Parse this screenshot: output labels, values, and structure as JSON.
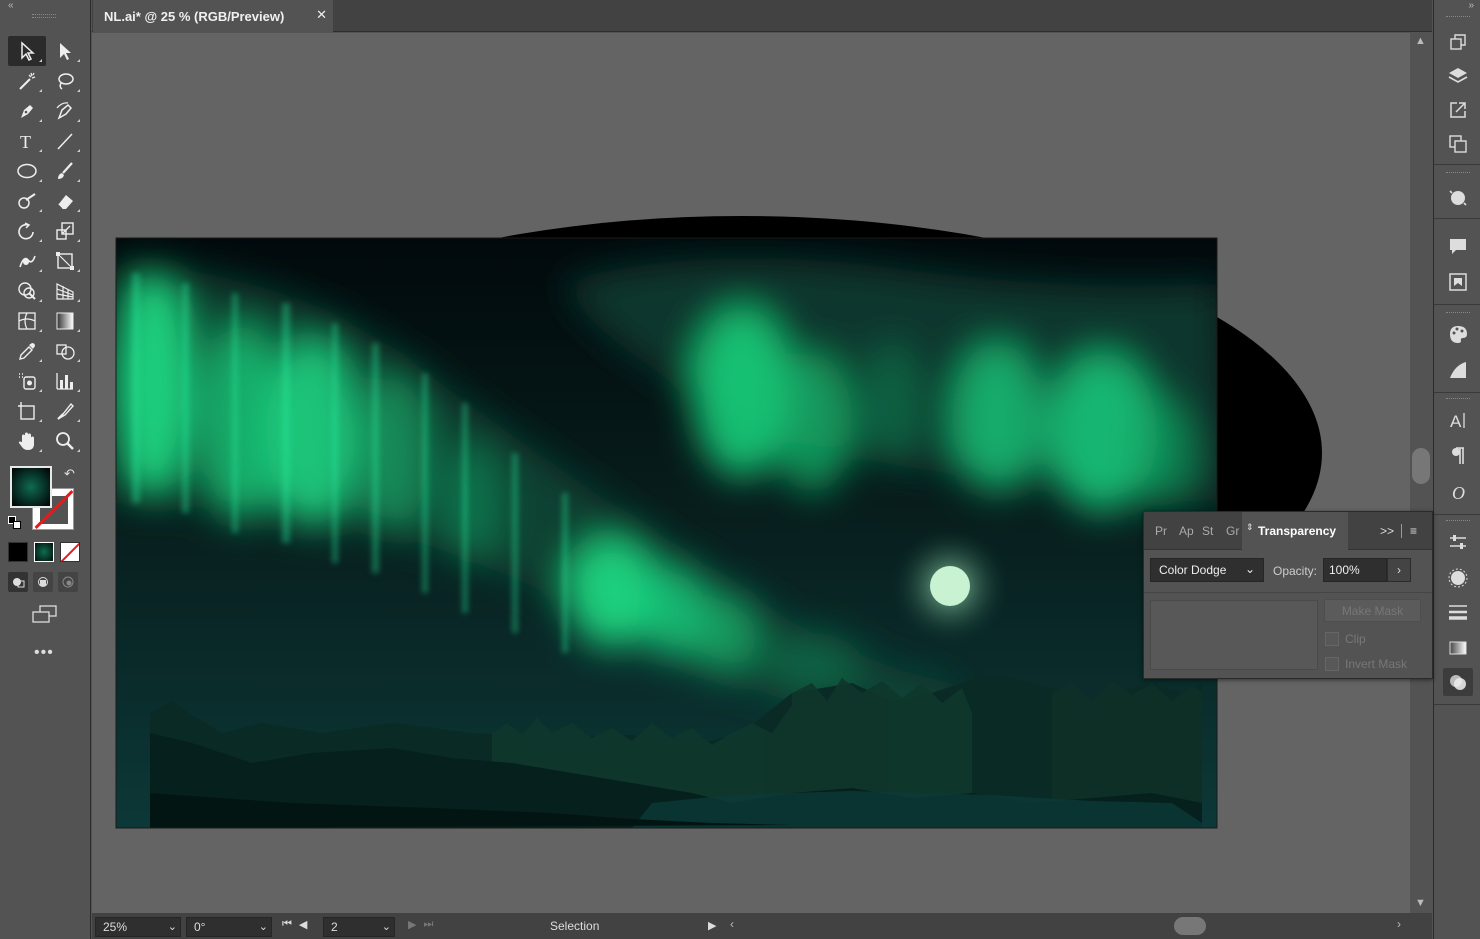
{
  "document": {
    "tab_title": "NL.ai* @ 25 % (RGB/Preview)",
    "close_glyph": "✕"
  },
  "toolbar": {
    "collapse_glyph": "«",
    "more_tools_glyph": "•••",
    "swap_glyph": "↶"
  },
  "statusbar": {
    "zoom": "25%",
    "rotation": "0°",
    "artboard": "2",
    "status": "Selection"
  },
  "transparency_panel": {
    "tabs": [
      "Pr",
      "Ap",
      "St",
      "Gr"
    ],
    "active_tab": "Transparency",
    "more_glyph": ">>",
    "menu_glyph": "≡",
    "blend_mode": "Color Dodge",
    "opacity_label": "Opacity:",
    "opacity_value": "100%",
    "make_mask": "Make Mask",
    "clip_label": "Clip",
    "invert_mask_label": "Invert Mask"
  },
  "rightdock": {
    "collapse_glyph": "»"
  },
  "colors": {
    "ui_bg": "#535353",
    "canvas_bg": "#646464",
    "aurora_green": "#1ee88a",
    "moon": "#c9f2d2",
    "sky_top": "#020b0d",
    "ground": "#0b2a28"
  }
}
